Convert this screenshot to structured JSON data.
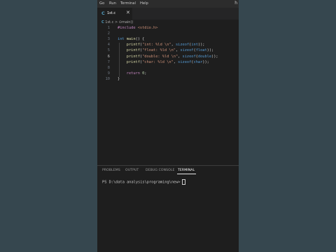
{
  "menu": {
    "items": [
      "Go",
      "Run",
      "Terminal",
      "Help"
    ],
    "window_control": "h"
  },
  "tab": {
    "icon_letter": "C",
    "label": "1st.c",
    "close": "✕"
  },
  "breadcrumb": {
    "icon_letter": "C",
    "file": "1st.c",
    "separator": ">",
    "symbol_icon": "⊙",
    "symbol": "main()"
  },
  "code": {
    "lines": [
      {
        "num": "1",
        "segments": [
          {
            "t": "#include ",
            "c": "pre"
          },
          {
            "t": "<stdio.h>",
            "c": "inc"
          }
        ]
      },
      {
        "num": "2",
        "segments": []
      },
      {
        "num": "3",
        "segments": [
          {
            "t": "int ",
            "c": "kw"
          },
          {
            "t": "main",
            "c": "fn"
          },
          {
            "t": "() {",
            "c": ""
          }
        ]
      },
      {
        "num": "4",
        "segments": [
          {
            "t": "    ",
            "c": ""
          },
          {
            "t": "printf",
            "c": "fn"
          },
          {
            "t": "(",
            "c": ""
          },
          {
            "t": "\"int: %ld \\n\"",
            "c": "str"
          },
          {
            "t": ", ",
            "c": ""
          },
          {
            "t": "sizeof",
            "c": "kw"
          },
          {
            "t": "(",
            "c": ""
          },
          {
            "t": "int",
            "c": "kw"
          },
          {
            "t": "));",
            "c": ""
          }
        ]
      },
      {
        "num": "5",
        "segments": [
          {
            "t": "    ",
            "c": ""
          },
          {
            "t": "printf",
            "c": "fn"
          },
          {
            "t": "(",
            "c": ""
          },
          {
            "t": "\"float: %ld \\n\"",
            "c": "str"
          },
          {
            "t": ", ",
            "c": ""
          },
          {
            "t": "sizeof",
            "c": "kw"
          },
          {
            "t": "(",
            "c": ""
          },
          {
            "t": "float",
            "c": "kw"
          },
          {
            "t": "));",
            "c": ""
          }
        ]
      },
      {
        "num": "6",
        "segments": [
          {
            "t": "    ",
            "c": ""
          },
          {
            "t": "printf",
            "c": "fn"
          },
          {
            "t": "(",
            "c": ""
          },
          {
            "t": "\"double: %ld \\n\"",
            "c": "str"
          },
          {
            "t": ", ",
            "c": ""
          },
          {
            "t": "sizeof",
            "c": "kw"
          },
          {
            "t": "(",
            "c": ""
          },
          {
            "t": "double",
            "c": "kw"
          },
          {
            "t": "));",
            "c": ""
          }
        ],
        "active": true
      },
      {
        "num": "7",
        "segments": [
          {
            "t": "    ",
            "c": ""
          },
          {
            "t": "printf",
            "c": "fn"
          },
          {
            "t": "(",
            "c": ""
          },
          {
            "t": "\"char: %ld \\n\"",
            "c": "str"
          },
          {
            "t": ", ",
            "c": ""
          },
          {
            "t": "sizeof",
            "c": "kw"
          },
          {
            "t": "(",
            "c": ""
          },
          {
            "t": "char",
            "c": "kw"
          },
          {
            "t": "));",
            "c": ""
          }
        ]
      },
      {
        "num": "8",
        "segments": []
      },
      {
        "num": "9",
        "segments": [
          {
            "t": "    ",
            "c": ""
          },
          {
            "t": "return ",
            "c": "pre"
          },
          {
            "t": "0",
            "c": "num"
          },
          {
            "t": ";",
            "c": ""
          }
        ]
      },
      {
        "num": "10",
        "segments": [
          {
            "t": "}",
            "c": ""
          }
        ]
      }
    ]
  },
  "panel": {
    "tabs": [
      "PROBLEMS",
      "OUTPUT",
      "DEBUG CONSOLE",
      "TERMINAL"
    ],
    "active_tab": "TERMINAL"
  },
  "terminal": {
    "prompt": "PS D:\\data analysis\\programing\\new>"
  },
  "colors": {
    "editor_bg": "#1e1e1e",
    "outer_bg": "#36474f",
    "keyword": "#569cd6",
    "function": "#dcdcaa",
    "string": "#ce9178"
  }
}
